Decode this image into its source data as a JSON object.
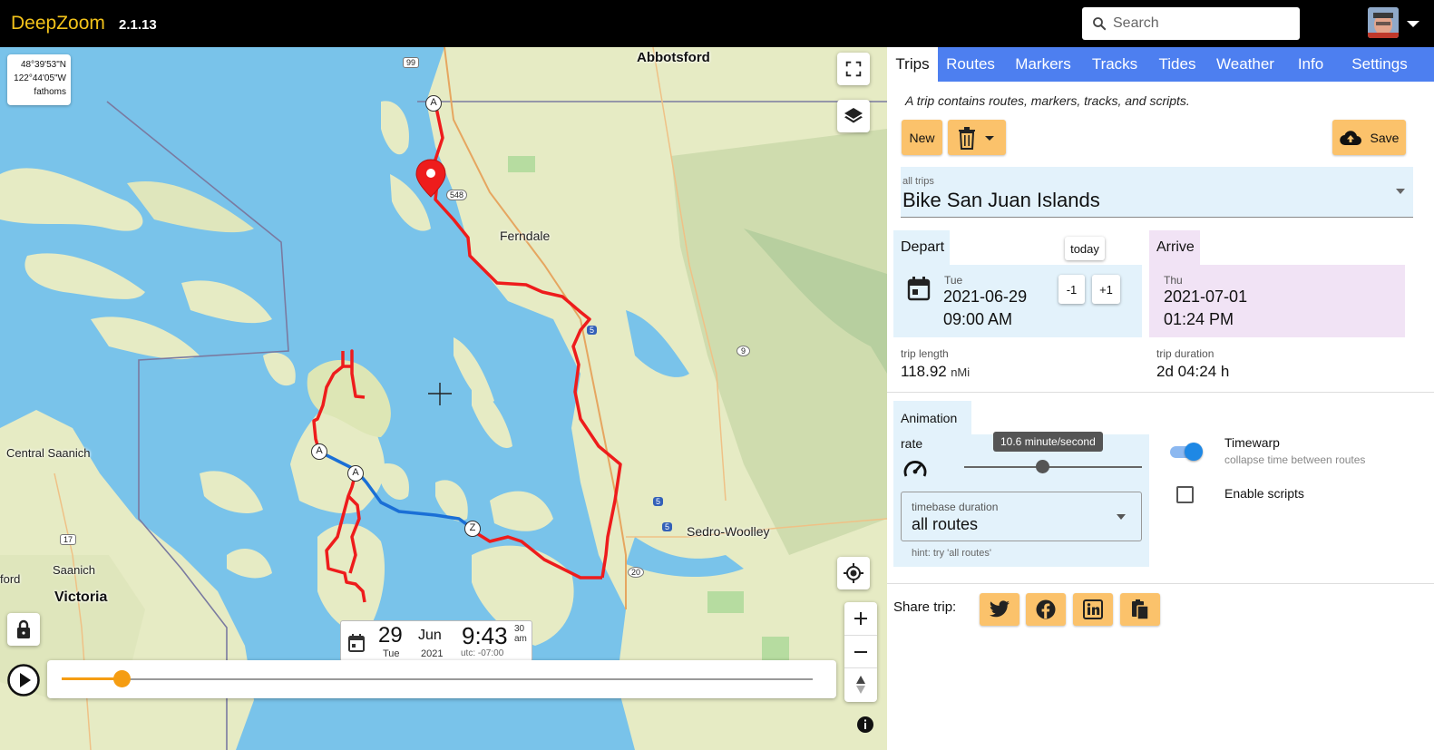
{
  "app": {
    "title": "DeepZoom",
    "version": "2.1.13",
    "search_placeholder": "Search"
  },
  "map": {
    "coords": {
      "lat": "48°39'53\"N",
      "lon": "122°44'05\"W",
      "units": "fathoms"
    },
    "place_labels": {
      "abbotsford": "Abbotsford",
      "ferndale": "Ferndale",
      "central_saanich": "Central Saanich",
      "saanich": "Saanich",
      "victoria": "Victoria",
      "sedro_woolley": "Sedro-Woolley",
      "ford": "ford"
    },
    "road_shields": [
      "99",
      "548",
      "5",
      "9",
      "5",
      "5",
      "20",
      "17"
    ],
    "waypoints": [
      "A",
      "A",
      "A",
      "Z"
    ],
    "datetime": {
      "day": "29",
      "weekday": "Tue",
      "month": "Jun",
      "year": "2021",
      "time": "9:43",
      "seconds": "30",
      "ampm": "am",
      "utc": "utc: -07:00"
    },
    "timeline_position": 0.08,
    "colors": {
      "route_red": "#ee1c1c",
      "route_blue": "#1a6fd6",
      "water": "#79c3ea",
      "land": "#e9edc8"
    }
  },
  "panel": {
    "tabs": [
      "Trips",
      "Routes",
      "Markers",
      "Tracks",
      "Tides",
      "Weather",
      "Info",
      "Settings"
    ],
    "active_tab": "Trips",
    "description": "A trip contains routes, markers, tracks, and scripts.",
    "buttons": {
      "new": "New",
      "save": "Save"
    },
    "trip_select": {
      "label": "all trips",
      "value": "Bike San Juan Islands"
    },
    "depart": {
      "title": "Depart",
      "today": "today",
      "weekday": "Tue",
      "date": "2021-06-29",
      "time": "09:00 AM",
      "minus": "-1",
      "plus": "+1"
    },
    "arrive": {
      "title": "Arrive",
      "weekday": "Thu",
      "date": "2021-07-01",
      "time": "01:24 PM"
    },
    "trip_length": {
      "label": "trip length",
      "value": "118.92",
      "unit": "nMi"
    },
    "trip_duration": {
      "label": "trip duration",
      "value": "2d 04:24 h"
    },
    "animation": {
      "title": "Animation",
      "rate_label": "rate",
      "rate_tooltip": "10.6 minute/second",
      "rate_fraction": 0.44,
      "timewarp_label": "Timewarp",
      "timewarp_sub": "collapse time between routes",
      "timewarp_on": true,
      "enable_scripts": "Enable scripts",
      "scripts_on": false,
      "timebase_label": "timebase duration",
      "timebase_value": "all routes",
      "hint": "hint: try 'all routes'"
    },
    "share_label": "Share trip:",
    "share_icons": [
      "twitter-icon",
      "facebook-icon",
      "linkedin-icon",
      "copy-icon"
    ],
    "colors": {
      "tab_bar": "#4d7ff0",
      "button": "#fbc26b",
      "depart_bg": "#e3f2fb",
      "arrive_bg": "#f1e3f5"
    }
  }
}
